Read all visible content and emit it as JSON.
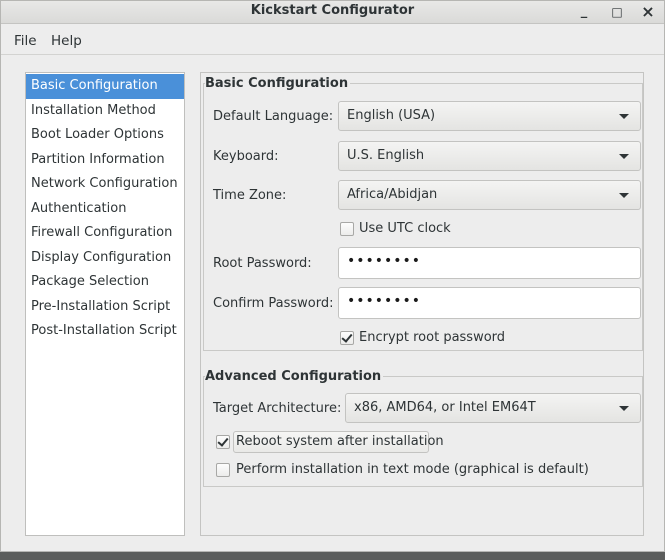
{
  "window": {
    "title": "Kickstart Configurator",
    "minimize_glyph": "_",
    "maximize_glyph": "□",
    "close_glyph": "×"
  },
  "menu": [
    "File",
    "Help"
  ],
  "sidebar": {
    "items": [
      {
        "label": "Basic Configuration",
        "selected": true
      },
      {
        "label": "Installation Method",
        "selected": false
      },
      {
        "label": "Boot Loader Options",
        "selected": false
      },
      {
        "label": "Partition Information",
        "selected": false
      },
      {
        "label": "Network Configuration",
        "selected": false
      },
      {
        "label": "Authentication",
        "selected": false
      },
      {
        "label": "Firewall Configuration",
        "selected": false
      },
      {
        "label": "Display Configuration",
        "selected": false
      },
      {
        "label": "Package Selection",
        "selected": false
      },
      {
        "label": "Pre-Installation Script",
        "selected": false
      },
      {
        "label": "Post-Installation Script",
        "selected": false
      }
    ]
  },
  "basic": {
    "section_title": "Basic Configuration",
    "language_label": "Default Language:",
    "language_value": "English (USA)",
    "keyboard_label": "Keyboard:",
    "keyboard_value": "U.S. English",
    "timezone_label": "Time Zone:",
    "timezone_value": "Africa/Abidjan",
    "utc_label": "Use UTC clock",
    "utc_checked": false,
    "root_pw_label": "Root Password:",
    "root_pw_value": "••••••••",
    "confirm_pw_label": "Confirm Password:",
    "confirm_pw_value": "••••••••",
    "encrypt_label": "Encrypt root password",
    "encrypt_checked": true
  },
  "advanced": {
    "section_title": "Advanced Configuration",
    "arch_label": "Target Architecture:",
    "arch_value": "x86, AMD64, or Intel EM64T",
    "reboot_label": "Reboot system after installation",
    "reboot_checked": true,
    "textmode_label": "Perform installation in text mode (graphical is default)",
    "textmode_checked": false
  },
  "colors": {
    "selection": "#4a90d9",
    "background": "#ededed"
  }
}
